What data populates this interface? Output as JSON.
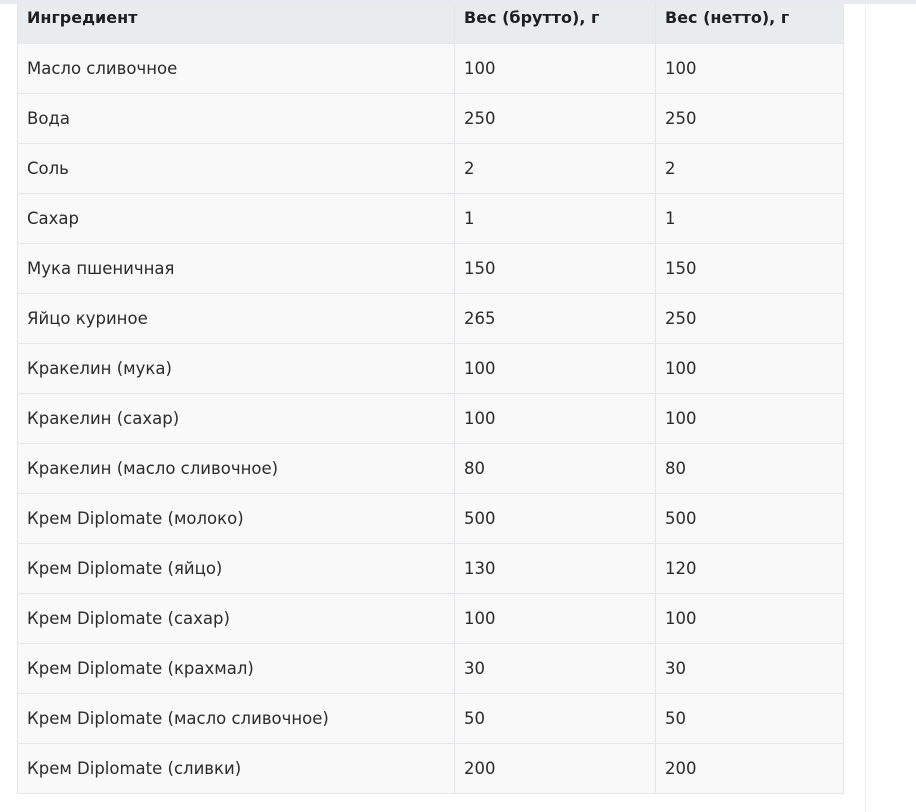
{
  "table": {
    "headers": [
      "Ингредиент",
      "Вес (брутто), г",
      "Вес (нетто), г"
    ],
    "rows": [
      [
        "Масло сливочное",
        "100",
        "100"
      ],
      [
        "Вода",
        "250",
        "250"
      ],
      [
        "Соль",
        "2",
        "2"
      ],
      [
        "Сахар",
        "1",
        "1"
      ],
      [
        "Мука пшеничная",
        "150",
        "150"
      ],
      [
        "Яйцо куриное",
        "265",
        "250"
      ],
      [
        "Кракелин (мука)",
        "100",
        "100"
      ],
      [
        "Кракелин (сахар)",
        "100",
        "100"
      ],
      [
        "Кракелин (масло сливочное)",
        "80",
        "80"
      ],
      [
        "Крем Diplomate (молоко)",
        "500",
        "500"
      ],
      [
        "Крем Diplomate (яйцо)",
        "130",
        "120"
      ],
      [
        "Крем Diplomate (сахар)",
        "100",
        "100"
      ],
      [
        "Крем Diplomate (крахмал)",
        "30",
        "30"
      ],
      [
        "Крем Diplomate (масло сливочное)",
        "50",
        "50"
      ],
      [
        "Крем Diplomate (сливки)",
        "200",
        "200"
      ]
    ]
  },
  "colors": {
    "header_background": "#e9ecef",
    "row_background": "#f9f9f9",
    "border": "#e4e6e9",
    "top_strip": "#e7ebf1"
  }
}
